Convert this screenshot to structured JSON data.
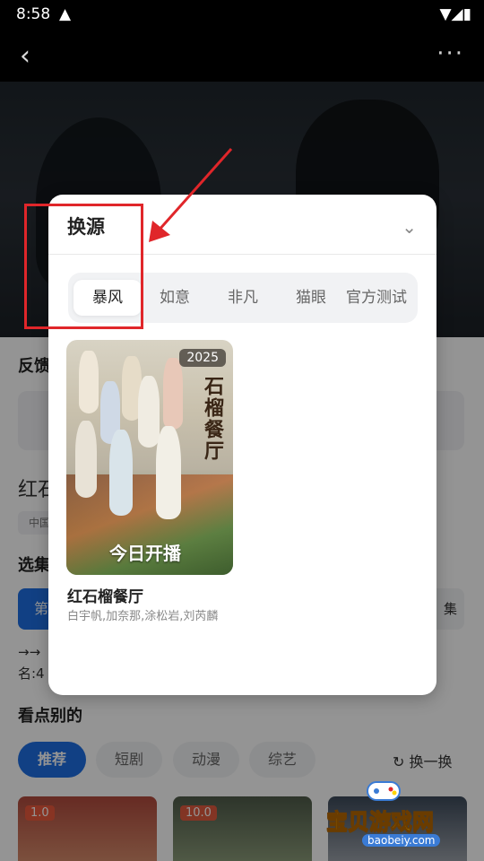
{
  "status": {
    "time": "8:58"
  },
  "feedback": "反馈",
  "red_title": "红石",
  "tag": "中国",
  "xuanji": "选集",
  "first_ep": "第",
  "right_btn": "集",
  "arrow_text": "→→",
  "name_text": "名:4",
  "see_section": "看点别的",
  "chips": [
    "推荐",
    "短剧",
    "动漫",
    "综艺"
  ],
  "refresh": "换一换",
  "cards": [
    {
      "score": "1.0"
    },
    {
      "score": "10.0"
    }
  ],
  "modal": {
    "title": "换源",
    "tabs": [
      "暴风",
      "如意",
      "非凡",
      "猫眼",
      "官方测试"
    ],
    "active_tab": "暴风",
    "item": {
      "year": "2025",
      "poster_title": "石榴餐厅",
      "poster_badge": "今日开播",
      "title": "红石榴餐厅",
      "cast": "白宇帆,加奈那,涂松岩,刘芮麟"
    }
  },
  "watermark": {
    "brand": "宝贝游戏网",
    "domain": "baobeiy.com"
  },
  "colors": {
    "accent": "#1e6fe3",
    "annotation": "#e0262a"
  }
}
